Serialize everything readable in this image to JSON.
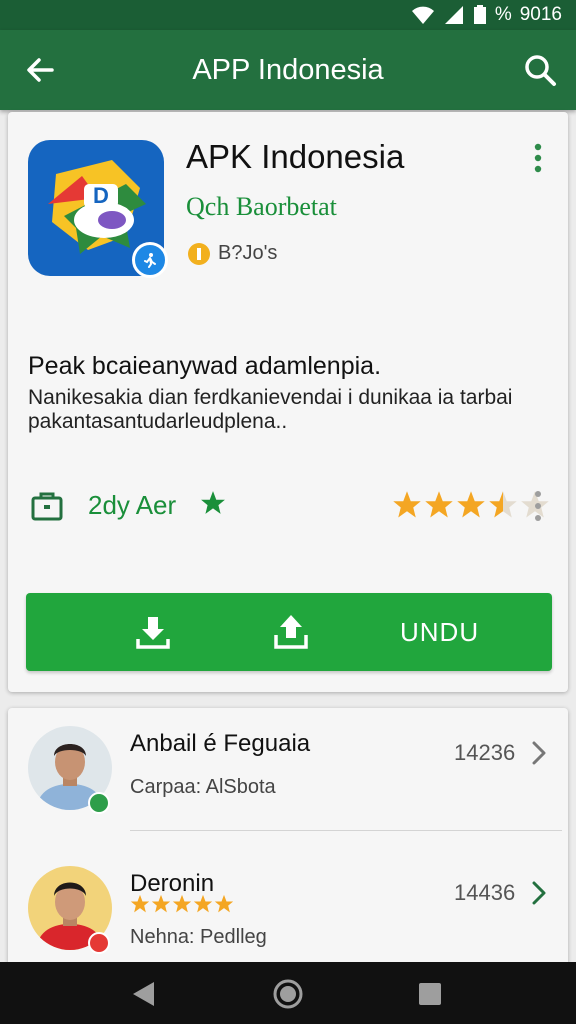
{
  "status_bar": {
    "time": "9016",
    "percent": "%"
  },
  "app_bar": {
    "title": "APP Indonesia"
  },
  "app": {
    "name": "APK Indonesia",
    "developer": "Qch Baorbetat",
    "badge_text": "B?Jo's",
    "icon_letter": "D",
    "description_title": "Peak bcaieanywad adamlenpia.",
    "description_body": "Nanikesakia dian ferdkanievendai i dunikaa ia tarbai pakantasantudarleudplena..",
    "info_label": "2dy Aer",
    "rating": 3.5,
    "install_label": "UNDU"
  },
  "list": [
    {
      "name": "Anbail é Feguaia",
      "sub": "Carpaa: AlSbota",
      "count": "14236"
    },
    {
      "name": "Deronin",
      "sub": "Nehna: Pedlleg",
      "count": "14436",
      "rating": 5
    }
  ],
  "colors": {
    "primary_dark": "#1b5e35",
    "primary": "#23703f",
    "accent_green": "#21a63d",
    "star": "#f4a623"
  },
  "icons": {
    "back": "arrow-left-icon",
    "search": "search-icon",
    "more": "more-vert-icon",
    "bag": "shopping-bag-icon",
    "download": "download-icon",
    "share": "share-icon",
    "chevron": "chevron-right-icon"
  }
}
